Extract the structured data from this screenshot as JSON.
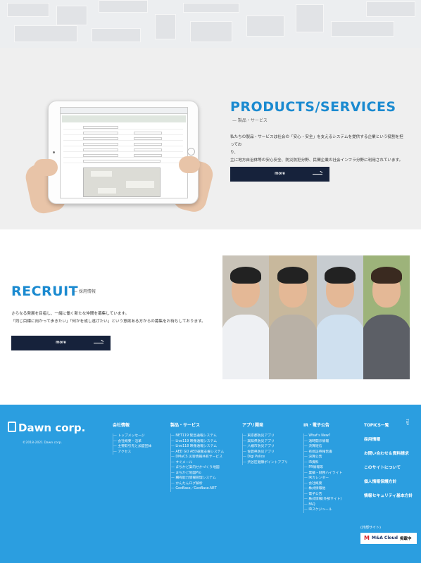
{
  "products": {
    "title": "PRODUCTS/SERVICES",
    "subtitle": "— 製品・サービス",
    "text_line1": "私たちの製品・サービスは社会の「安心・安全」を支えるシステムを提供する企業という役割を担ってお",
    "text_line2": "り、",
    "text_line3": "主に地方自治体等の安心安全、防災防犯分野、民間企業の社会インフラ分野に利用されています。",
    "more": "more"
  },
  "recruit": {
    "title": "RECRUIT",
    "subtitle": "— 採用情報",
    "text_line1": "さらなる発展を目指し、一緒に働く新たな仲間を募集しています。",
    "text_line2": "「同じ目標に向かって歩きたい」「何かを成し遂げたい」という意欲ある方からの募集をお待ちしております。",
    "more": "more"
  },
  "footer": {
    "logo": "Dawn corp.",
    "copyright": "©2018-2021 Dawn corp.",
    "pagetop": "TOP",
    "columns": [
      {
        "heading": "会社情報",
        "items": [
          "トップメッセージ",
          "会社概要・沿革",
          "主要取引先と加盟団体",
          "アクセス"
        ]
      },
      {
        "heading": "製品・サービス",
        "items": [
          "NET119 緊急通報システム",
          "Live119 映像通報システム",
          "Live118 映像通報システム",
          "AED GO AED運搬支援システム",
          "DMaCS 災害情報共有サービス",
          "すぐメール",
          "まちかど案内せかづくり地図",
          "まちかど地図Pro",
          "構有能力情報管理システム",
          "かんたんログ解析",
          "GeoBase／GeoBase.NET"
        ]
      },
      {
        "heading": "アプリ開発",
        "items": [
          "東京都防災アプリ",
          "高知県防災アプリ",
          "八幡市防災アプリ",
          "佐賀県防災アプリ",
          "Digi Police",
          "渋谷区健康ポイントアプリ"
        ]
      },
      {
        "heading": "IR・電子公告",
        "items": [
          "What's New?",
          "適時開示情報",
          "決算短信",
          "有価証券報告書",
          "決算公告",
          "IR資料",
          "PR情報等",
          "業績・財務ハイライト",
          "IRカレンダー",
          "会社概要",
          "株式情報他",
          "電子公告",
          "株式情報(外部サイト)",
          "FAQ",
          "IRスケジュール"
        ]
      }
    ],
    "topics": [
      "TOPICS一覧",
      "採用情報",
      "お問い合わせ＆資料請求",
      "このサイトについて",
      "個人情報保護方針",
      "情報セキュリティ基本方針"
    ],
    "external_label": "(外部サイト)",
    "banner_mark": "M",
    "banner_text": "M&A Cloud",
    "banner_badge": "掲載中"
  },
  "colors": {
    "accent": "#1a8ad0",
    "button": "#16223b",
    "footer": "#2b9ee0"
  }
}
